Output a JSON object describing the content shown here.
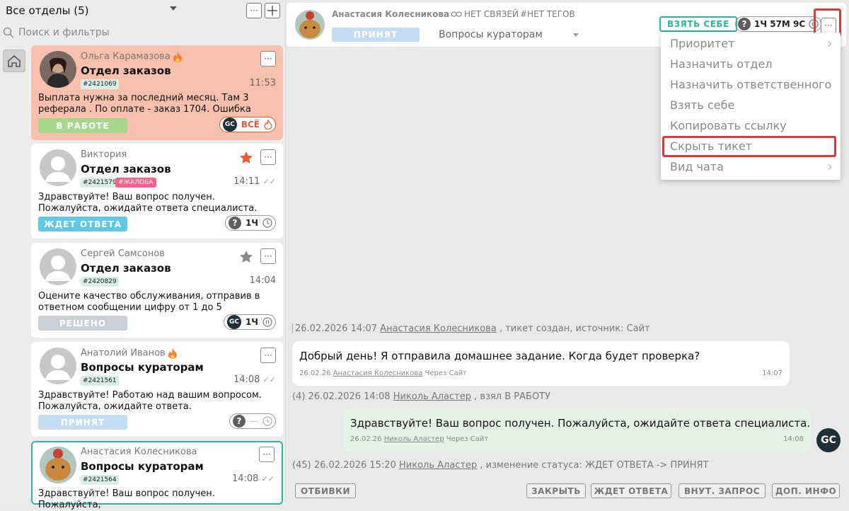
{
  "sidebar": {
    "dept_selector": "Все отделы (5)",
    "search_placeholder": "Поиск и фильтры",
    "more_icon": "ellipsis-icon",
    "add_icon": "plus-icon"
  },
  "tickets": [
    {
      "name": "Ольга Карамазова",
      "dept": "Отдел заказов",
      "id": "#2421069",
      "time": "11:53",
      "message": "Выплата нужна за последний месяц. Там 3 реферала . По оплате - заказ 1704. Ошибка возникает сразу...",
      "status": "В РАБОТЕ",
      "status_color": "#a5d88d",
      "timer_label": "ВСЁ",
      "card_color": "#f9c1ad"
    },
    {
      "name": "Виктория",
      "dept": "Отдел заказов",
      "id": "#2421579",
      "tag": "#ЖАЛОБА",
      "time": "14:11",
      "message": "Здравствуйте! Ваш вопрос получен. Пожалуйста, ожидайте ответа специалиста.",
      "status": "ЖДЕТ ОТВЕТА",
      "status_color": "#5fc8e2",
      "timer_label": "1Ч"
    },
    {
      "name": "Сергей Самсонов",
      "dept": "Отдел заказов",
      "id": "#2420829",
      "time": "14:04",
      "message": "Оцените качество обслуживания, отправив в ответном сообщении цифру от 1 до 5",
      "status": "РЕШЕНО",
      "status_color": "#c9d0d6",
      "timer_label": "1Ч"
    },
    {
      "name": "Анатолий Иванов",
      "dept": "Вопросы кураторам",
      "id": "#2421561",
      "time": "14:08",
      "message": "Здравствуйте! Работаю над вашим вопросом. Пожалуйста, ожидайте ответа.",
      "status": "ПРИНЯТ",
      "status_color": "#c5ddf3",
      "timer_label": "—"
    },
    {
      "name": "Анастасия Колесникова",
      "dept": "Вопросы кураторам",
      "id": "#2421564",
      "time": "14:08",
      "message": "Здравствуйте! Ваш вопрос получен. Пожалуйста,"
    }
  ],
  "header": {
    "name": "Анастасия Колесникова",
    "links": "НЕТ СВЯЗЕЙ",
    "tags": "#НЕТ ТЕГОВ",
    "status": "ПРИНЯТ",
    "dept": "Вопросы кураторам",
    "take_btn": "ВЗЯТЬ СЕБЕ",
    "timer": "1Ч 57М 9С"
  },
  "menu": {
    "items": [
      "Приоритет",
      "Назначить отдел",
      "Назначить ответственного",
      "Взять себе",
      "Копировать ссылку",
      "Скрыть тикет",
      "Вид чата"
    ]
  },
  "chat": {
    "sys1_time": "26.02.2026 14:07",
    "sys1_user": "Анастасия Колесникова",
    "sys1_rest": ", тикет создан, источник: Сайт",
    "msg1_text": "Добрый день! Я отправила домашнее задание. Когда будет проверка?",
    "msg1_date": "26.02.26",
    "msg1_user": "Анастасия Колесникова",
    "msg1_via": "Через Сайт",
    "msg1_time": "14:07",
    "sys2_prefix": "(4) 26.02.2026 14:08",
    "sys2_user": "Николь Аластер",
    "sys2_rest": ", взял В РАБОТУ",
    "msg2_text": "Здравствуйте! Ваш вопрос получен. Пожалуйста, ожидайте ответа специалиста.",
    "msg2_date": "26.02.26",
    "msg2_user": "Николь Аластер",
    "msg2_via": "Через Сайт",
    "msg2_time": "14:08",
    "agent_badge": "GC",
    "sys3_prefix": "(45) 26.02.2026 15:20",
    "sys3_user": "Николь Аластер",
    "sys3_rest": ", изменение статуса: ЖДЕТ ОТВЕТА -> ПРИНЯТ"
  },
  "actions": {
    "templates": "ОТБИВКИ",
    "close": "ЗАКРЫТЬ",
    "await": "ЖДЕТ ОТВЕТА",
    "internal": "ВНУТ. ЗАПРОС",
    "more_info": "ДОП. ИНФО"
  },
  "colors": {
    "accent": "#2bb79b",
    "highlight": "#d93a3a"
  }
}
